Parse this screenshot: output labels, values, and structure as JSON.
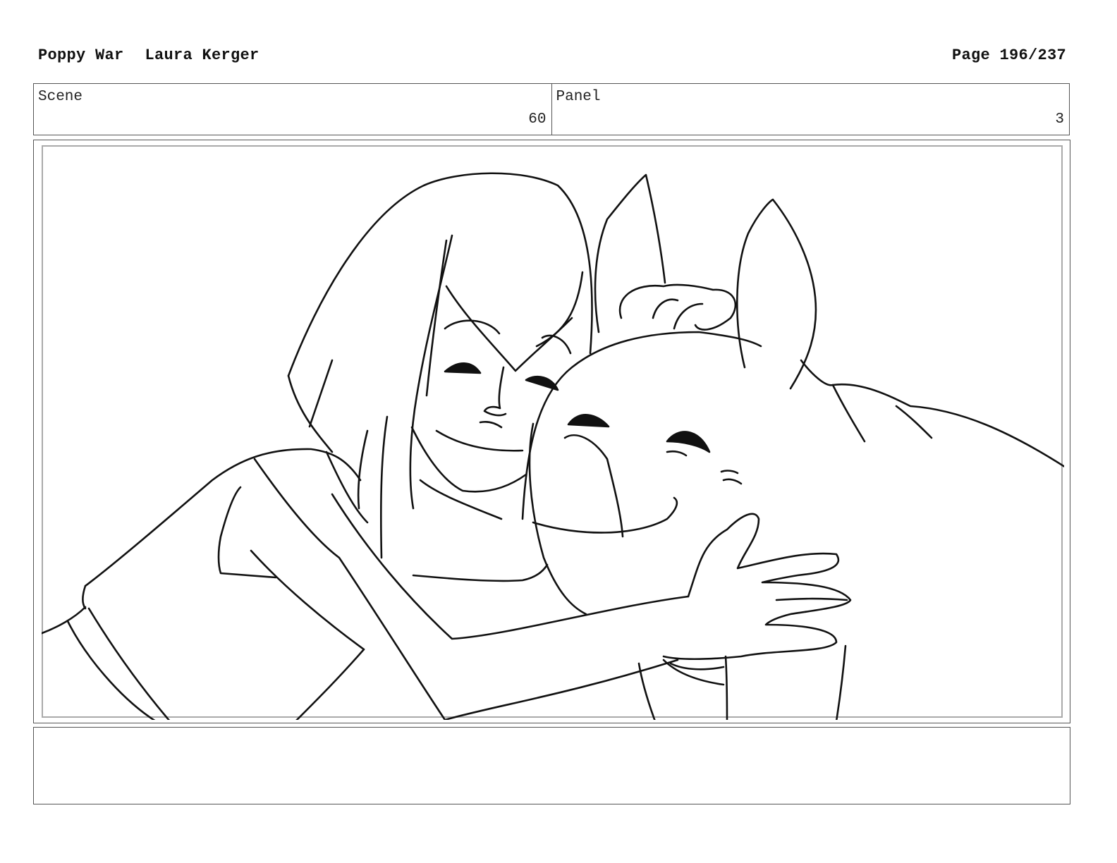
{
  "header": {
    "project_title": "Poppy War",
    "author": "Laura Kerger",
    "page_label": "Page 196/237"
  },
  "info": {
    "scene_label": "Scene",
    "scene_value": "60",
    "panel_label": "Panel",
    "panel_value": "3"
  },
  "panel_image": {
    "subject": "girl-hugging-creature-sketch",
    "style": "black line drawing on white"
  },
  "notes": {
    "text": ""
  }
}
